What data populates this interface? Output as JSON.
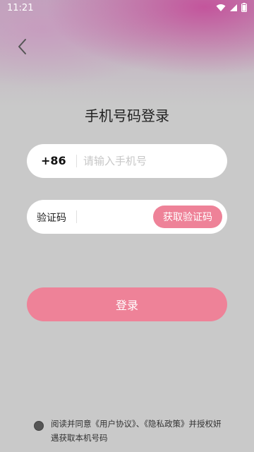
{
  "status_bar": {
    "time": "11:21",
    "icons": [
      "wifi-icon",
      "signal-icon",
      "battery-icon"
    ]
  },
  "nav": {
    "back_icon": "chevron-left-icon"
  },
  "title": "手机号码登录",
  "phone": {
    "prefix": "+86",
    "placeholder": "请输入手机号",
    "value": ""
  },
  "code": {
    "label": "验证码",
    "value": "",
    "get_code_label": "获取验证码"
  },
  "login_label": "登录",
  "agreement": {
    "text_before": "阅读并同意",
    "user_agreement": "《用户协议》",
    "separator": "、",
    "privacy_policy": "《隐私政策》",
    "text_after": "并授权妍遇获取本机号码",
    "checked": false
  },
  "colors": {
    "accent": "#ee8298",
    "background": "#c9c9c9",
    "gradient_top": "#c446a0"
  }
}
